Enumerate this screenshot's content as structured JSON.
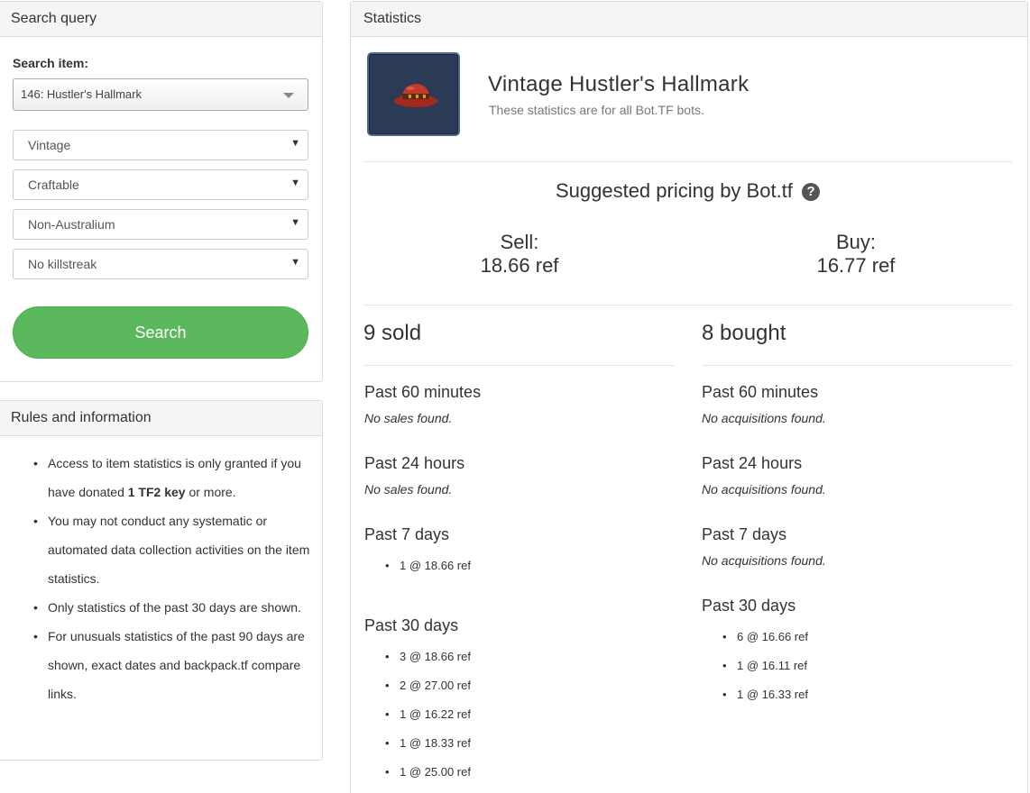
{
  "search_panel": {
    "heading": "Search query",
    "search_item_label": "Search item:",
    "search_item_value": "146: Hustler's Hallmark",
    "quality": "Vintage",
    "craftable": "Craftable",
    "australium": "Non-Australium",
    "killstreak": "No killstreak",
    "search_button": "Search"
  },
  "rules_panel": {
    "heading": "Rules and information",
    "rule1_pre": "Access to item statistics is only granted if you have donated ",
    "rule1_bold": "1 TF2 key",
    "rule1_post": " or more.",
    "rule2": "You may not conduct any systematic or automated data collection activities on the item statistics.",
    "rule3": "Only statistics of the past 30 days are shown.",
    "rule4": "For unusuals statistics of the past 90 days are shown, exact dates and backpack.tf compare links."
  },
  "stats_panel": {
    "heading": "Statistics",
    "item_name": "Vintage Hustler's Hallmark",
    "item_subtitle": "These statistics are for all Bot.TF bots.",
    "suggested_title": "Suggested pricing by Bot.tf",
    "help_icon_glyph": "?",
    "sell_label": "Sell:",
    "sell_value": "18.66 ref",
    "buy_label": "Buy:",
    "buy_value": "16.77 ref",
    "sold": {
      "title": "9 sold",
      "p60_label": "Past 60 minutes",
      "p60_none": "No sales found.",
      "p24_label": "Past 24 hours",
      "p24_none": "No sales found.",
      "p7_label": "Past 7 days",
      "p7_items": [
        "1 @ 18.66 ref"
      ],
      "p30_label": "Past 30 days",
      "p30_items": [
        "3 @ 18.66 ref",
        "2 @ 27.00 ref",
        "1 @ 16.22 ref",
        "1 @ 18.33 ref",
        "1 @ 25.00 ref"
      ]
    },
    "bought": {
      "title": "8 bought",
      "p60_label": "Past 60 minutes",
      "p60_none": "No acquisitions found.",
      "p24_label": "Past 24 hours",
      "p24_none": "No acquisitions found.",
      "p7_label": "Past 7 days",
      "p7_none": "No acquisitions found.",
      "p30_label": "Past 30 days",
      "p30_items": [
        "6 @ 16.66 ref",
        "1 @ 16.11 ref",
        "1 @ 16.33 ref"
      ]
    }
  },
  "colors": {
    "search_button": "#5cb85c",
    "item_background": "#2b3a55",
    "item_border": "#4a6b96",
    "hat_red": "#c0392b"
  }
}
